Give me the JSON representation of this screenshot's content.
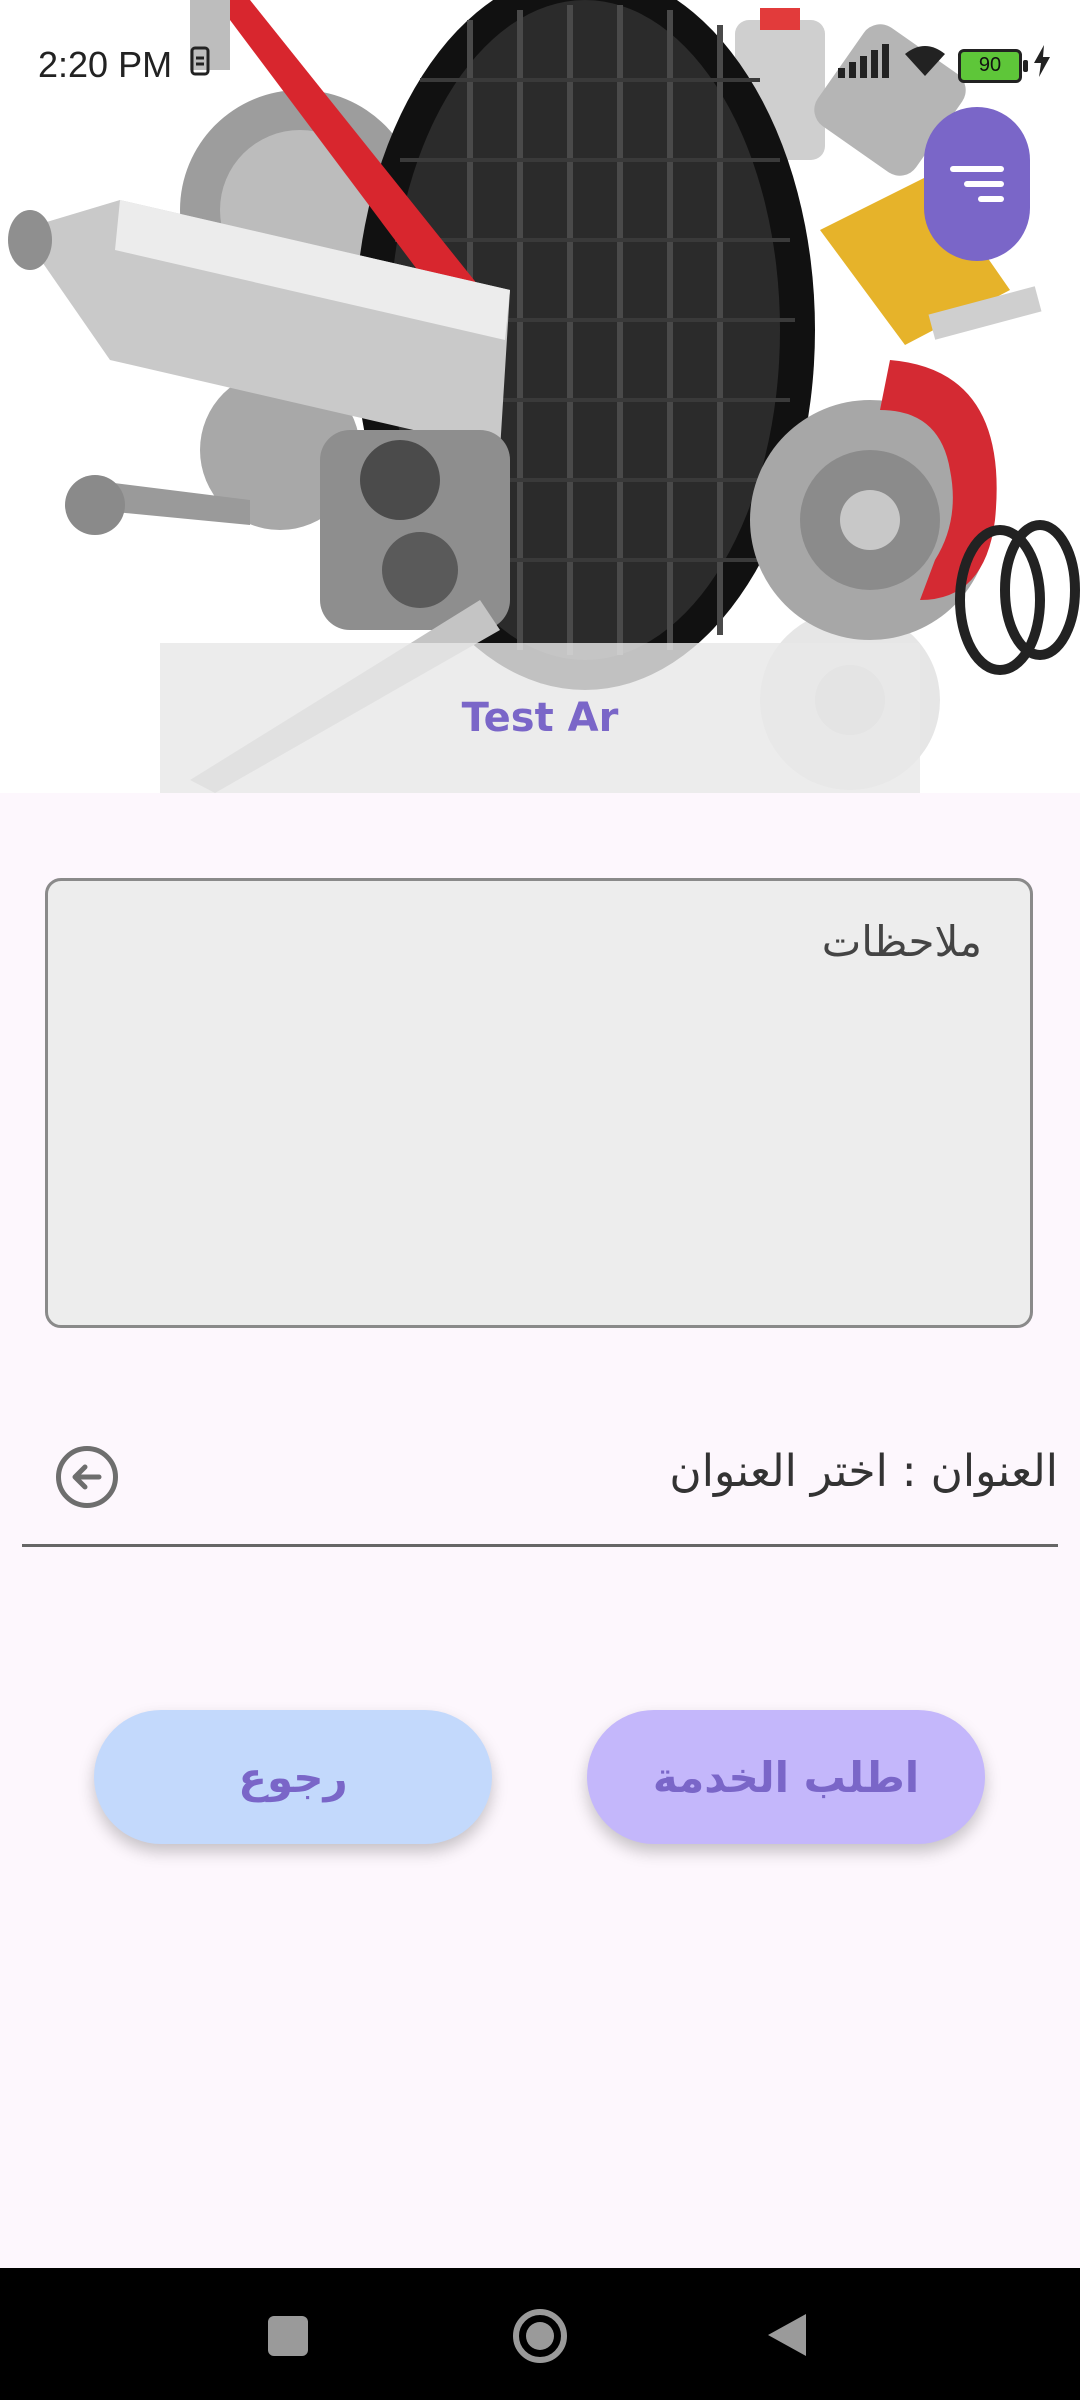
{
  "status_bar": {
    "time": "2:20 PM",
    "sim_icon": "sim-card-icon",
    "battery_level": "90"
  },
  "hero": {
    "title": "Test Ar",
    "image": "auto-parts-illustration"
  },
  "menu": {
    "icon": "filter-menu-icon"
  },
  "notes": {
    "placeholder": "ملاحظات"
  },
  "address": {
    "text": "العنوان : اختر العنوان",
    "icon": "arrow-left-circle-icon"
  },
  "buttons": {
    "back_label": "رجوع",
    "request_label": "اطلب الخدمة"
  },
  "colors": {
    "accent": "#7a66c8",
    "back_button": "#c3d9fc",
    "request_button": "#c4b7fb",
    "background": "#fdf7fd"
  }
}
